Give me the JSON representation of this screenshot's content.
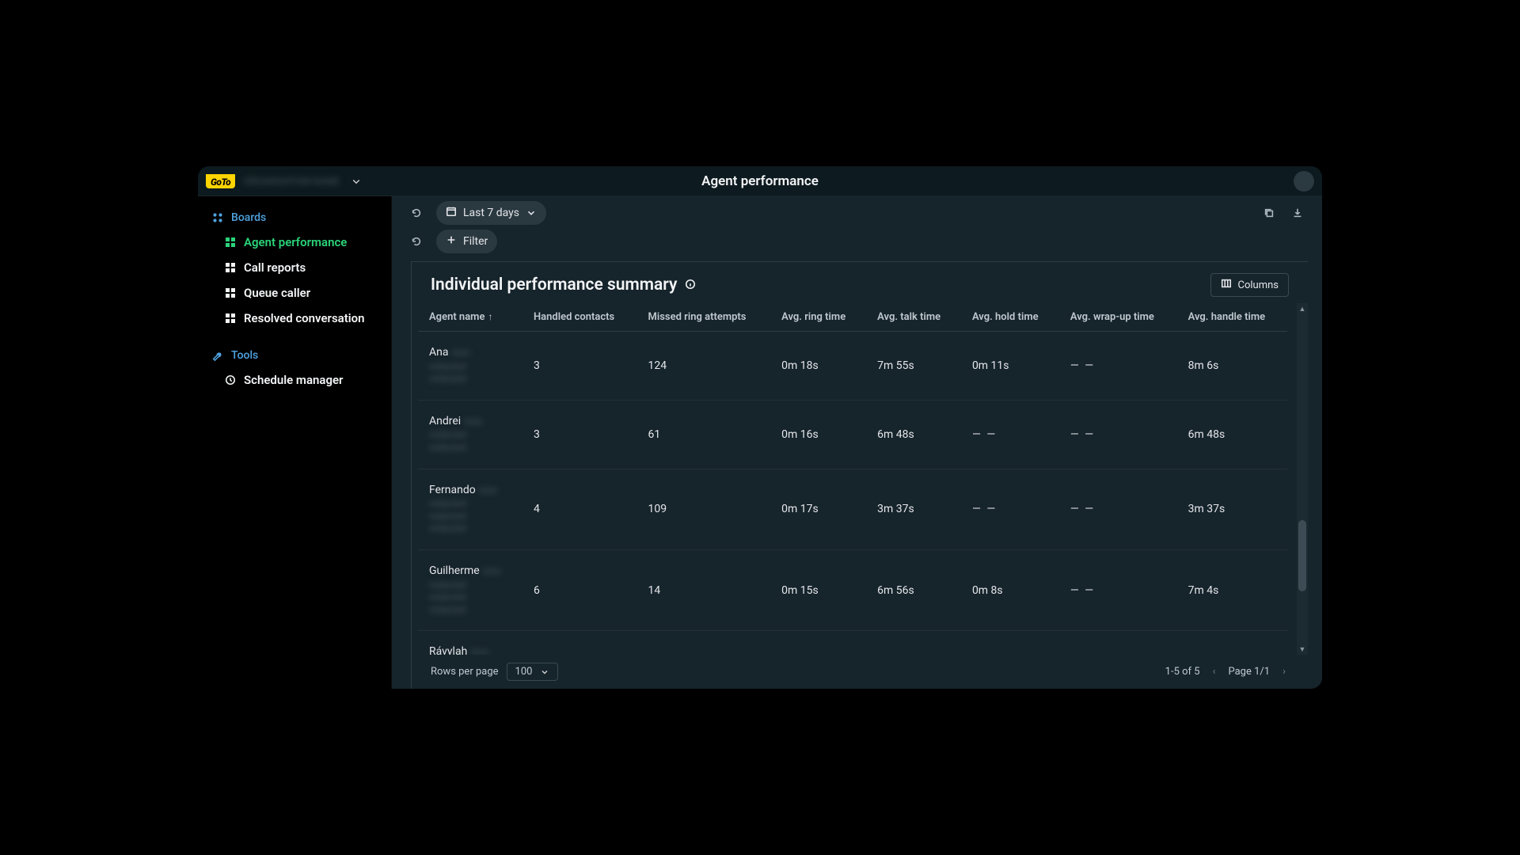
{
  "header": {
    "logo": "GoTo",
    "org_placeholder": "ORGANIZATION NAME",
    "title": "Agent performance"
  },
  "sidebar": {
    "boards_label": "Boards",
    "items": [
      {
        "label": "Agent performance",
        "active": true
      },
      {
        "label": "Call reports",
        "active": false
      },
      {
        "label": "Queue caller",
        "active": false
      },
      {
        "label": "Resolved conversation",
        "active": false
      }
    ],
    "tools_label": "Tools",
    "tools_items": [
      {
        "label": "Schedule manager"
      }
    ]
  },
  "toolbar": {
    "date_range": "Last 7 days",
    "filter_label": "Filter"
  },
  "section": {
    "title": "Individual performance summary",
    "columns_btn": "Columns"
  },
  "table": {
    "columns": [
      "Agent name",
      "Handled contacts",
      "Missed ring attempts",
      "Avg. ring time",
      "Avg. talk time",
      "Avg. hold time",
      "Avg. wrap-up time",
      "Avg. handle time"
    ],
    "sort_col": 0,
    "sort_dir": "asc",
    "rows": [
      {
        "agent": "Ana",
        "sub": [
          "redacted",
          "redacted"
        ],
        "handled": "3",
        "missed": "124",
        "ring": "0m 18s",
        "talk": "7m 55s",
        "hold": "0m 11s",
        "wrap": "— —",
        "handle": "8m 6s"
      },
      {
        "agent": "Andrei",
        "sub": [
          "redacted",
          "redacted"
        ],
        "handled": "3",
        "missed": "61",
        "ring": "0m 16s",
        "talk": "6m 48s",
        "hold": "— —",
        "wrap": "— —",
        "handle": "6m 48s"
      },
      {
        "agent": "Fernando",
        "sub": [
          "redacted",
          "redacted",
          "redacted"
        ],
        "handled": "4",
        "missed": "109",
        "ring": "0m 17s",
        "talk": "3m 37s",
        "hold": "— —",
        "wrap": "— —",
        "handle": "3m 37s"
      },
      {
        "agent": "Guilherme",
        "sub": [
          "redacted",
          "redacted",
          "redacted"
        ],
        "handled": "6",
        "missed": "14",
        "ring": "0m 15s",
        "talk": "6m 56s",
        "hold": "0m 8s",
        "wrap": "— —",
        "handle": "7m 4s"
      },
      {
        "agent": "Rávylah",
        "sub": [],
        "handled": "",
        "missed": "",
        "ring": "",
        "talk": "",
        "hold": "",
        "wrap": "",
        "handle": ""
      }
    ]
  },
  "pagination": {
    "rows_label": "Rows per page",
    "rows_value": "100",
    "range": "1-5 of 5",
    "page": "Page 1/1"
  }
}
